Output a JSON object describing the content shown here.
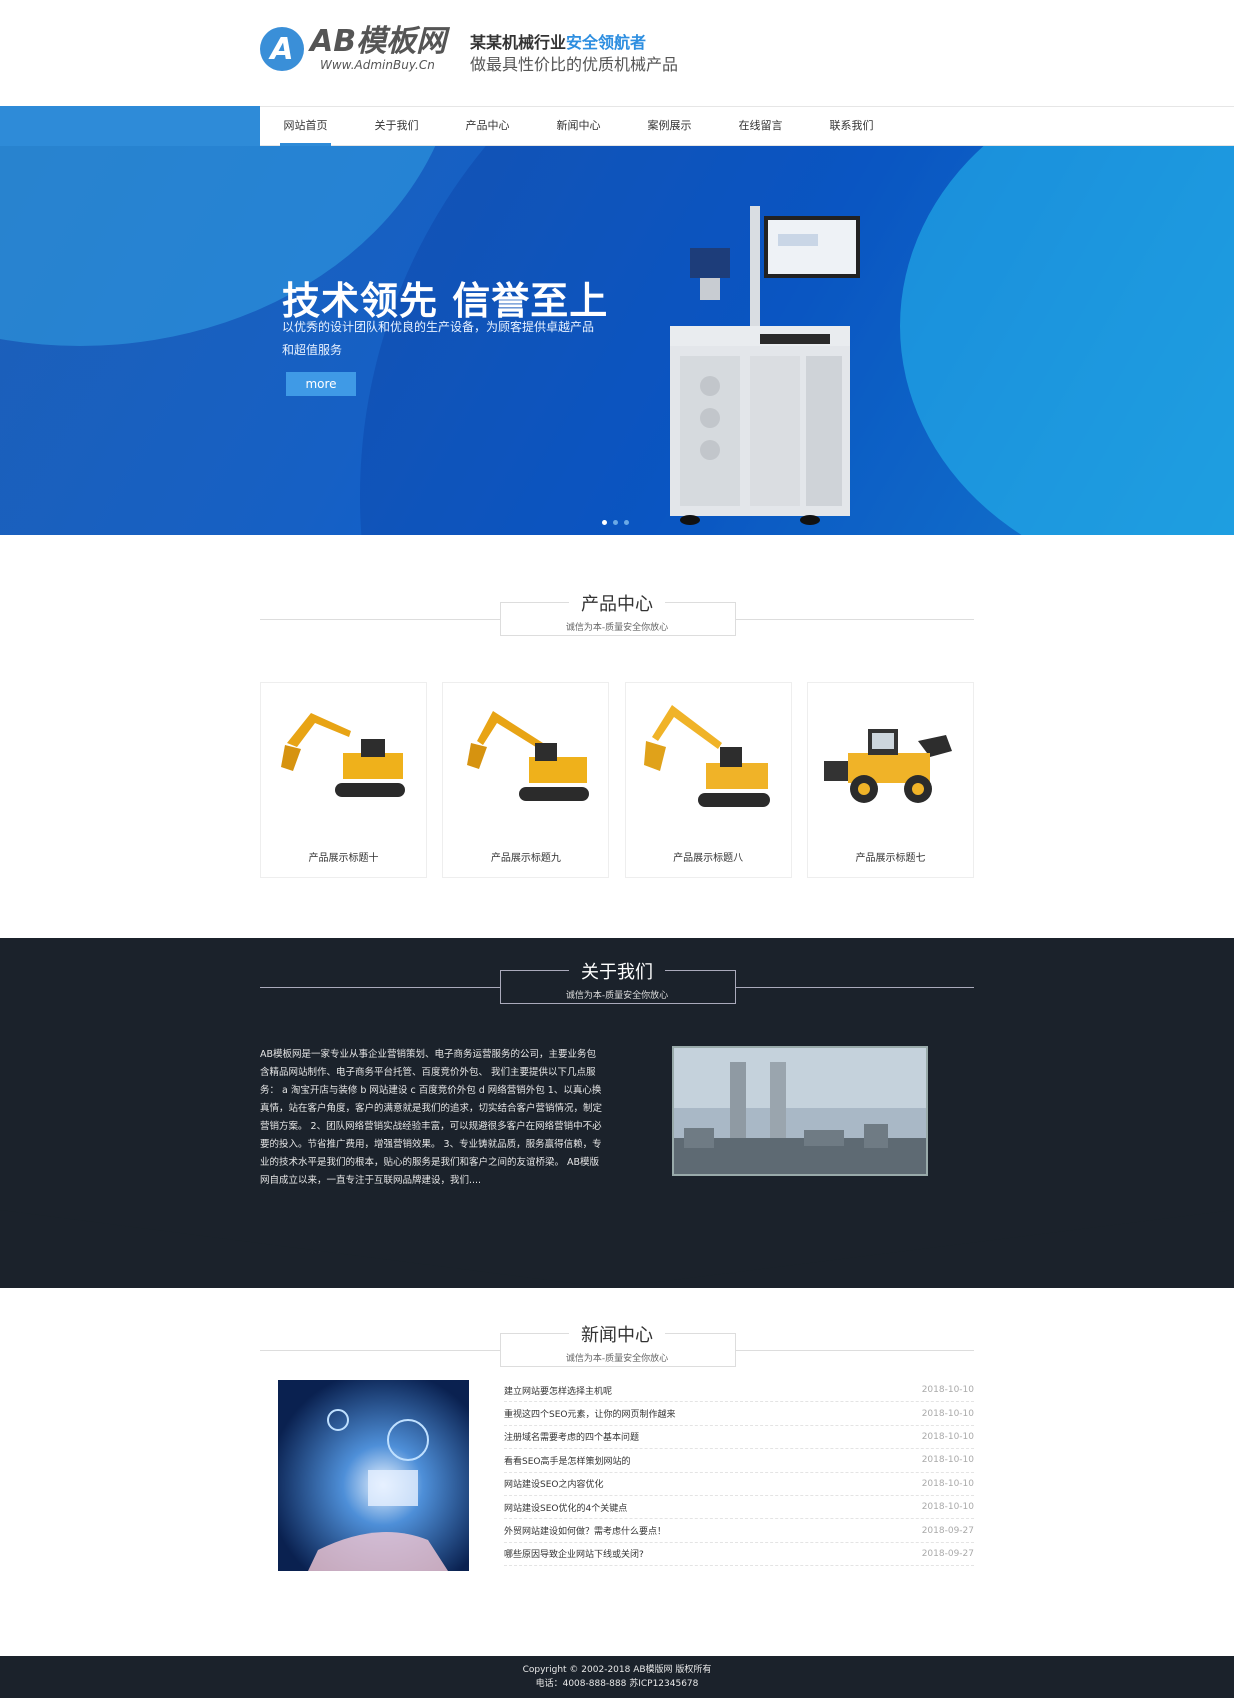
{
  "header": {
    "logo_letter": "A",
    "logo_name": "AB模板网",
    "logo_url": "Www.AdminBuy.Cn",
    "slogan_prefix": "某某机械行业",
    "slogan_accent": "安全领航者",
    "slogan_line2": "做最具性价比的优质机械产品"
  },
  "nav": {
    "items": [
      {
        "label": "网站首页",
        "active": true
      },
      {
        "label": "关于我们"
      },
      {
        "label": "产品中心"
      },
      {
        "label": "新闻中心"
      },
      {
        "label": "案例展示"
      },
      {
        "label": "在线留言"
      },
      {
        "label": "联系我们"
      }
    ]
  },
  "banner": {
    "title": "技术领先 信誉至上",
    "subtitle": "以优秀的设计团队和优良的生产设备，为顾客提供卓越产品和超值服务",
    "button": "more",
    "slides": 3,
    "active_slide": 1
  },
  "products": {
    "title": "产品中心",
    "subtitle": "诚信为本-质量安全你放心",
    "items": [
      {
        "caption": "产品展示标题十",
        "icon": "excavator-image"
      },
      {
        "caption": "产品展示标题九",
        "icon": "excavator-image"
      },
      {
        "caption": "产品展示标题八",
        "icon": "excavator-image"
      },
      {
        "caption": "产品展示标题七",
        "icon": "wheel-loader-image"
      }
    ]
  },
  "about": {
    "title": "关于我们",
    "subtitle": "诚信为本-质量安全你放心",
    "text": "AB模板网是一家专业从事企业营销策划、电子商务运营服务的公司，主要业务包含精品网站制作、电子商务平台托管、百度竞价外包、 我们主要提供以下几点服务： a 淘宝开店与装修 b 网站建设 c 百度竞价外包 d 网络营销外包 1、以真心换真情，站在客户角度，客户的满意就是我们的追求，切实结合客户营销情况，制定营销方案。 2、团队网络营销实战经验丰富，可以规避很多客户在网络营销中不必要的投入。节省推广费用，增强营销效果。 3、专业铸就品质，服务赢得信赖，专业的技术水平是我们的根本，贴心的服务是我们和客户之间的友谊桥梁。 AB模版网自成立以来，一直专注于互联网品牌建设，我们....",
    "image": "factory-chimney-image"
  },
  "news": {
    "title": "新闻中心",
    "subtitle": "诚信为本-质量安全你放心",
    "image": "digital-hand-image",
    "items": [
      {
        "title": "建立网站要怎样选择主机呢",
        "date": "2018-10-10"
      },
      {
        "title": "重视这四个SEO元素，让你的网页制作越来",
        "date": "2018-10-10"
      },
      {
        "title": "注册域名需要考虑的四个基本问题",
        "date": "2018-10-10"
      },
      {
        "title": "看看SEO高手是怎样策划网站的",
        "date": "2018-10-10"
      },
      {
        "title": "网站建设SEO之内容优化",
        "date": "2018-10-10"
      },
      {
        "title": "网站建设SEO优化的4个关键点",
        "date": "2018-10-10"
      },
      {
        "title": "外贸网站建设如何做？需考虑什么要点！",
        "date": "2018-09-27"
      },
      {
        "title": "哪些原因导致企业网站下线或关闭?",
        "date": "2018-09-27"
      }
    ]
  },
  "footer": {
    "copyright": "Copyright © 2002-2018 AB模版网 版权所有",
    "contact": "电话：4008-888-888   苏ICP12345678"
  },
  "colors": {
    "accent": "#2e8bd8",
    "dark": "#1b222b"
  }
}
